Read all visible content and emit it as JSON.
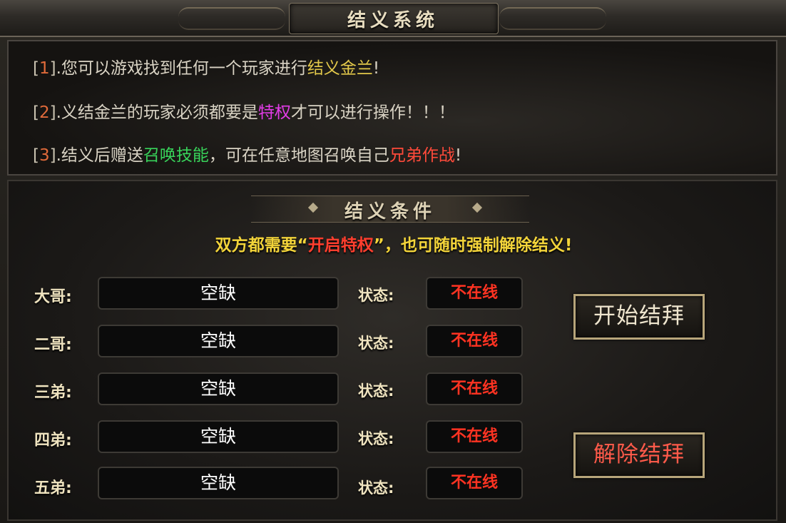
{
  "window": {
    "title": "结义系统"
  },
  "info": {
    "lines": [
      {
        "bl": "[",
        "num": "1",
        "br": "]",
        "pre": ".您可以游戏找到任何一个玩家进行",
        "hl": "结义金兰",
        "post": "!"
      },
      {
        "bl": "[",
        "num": "2",
        "br": "]",
        "pre": ".义结金兰的玩家必须都要是",
        "hl": "特权",
        "post": "才可以进行操作！！！"
      },
      {
        "bl": "[",
        "num": "3",
        "br": "]",
        "pre": ".结义后赠送",
        "hl": "召唤技能",
        "mid": "，可在任意地图召唤自己",
        "hl2": "兄弟作战",
        "post": "!"
      }
    ]
  },
  "conditions": {
    "title": "结义条件",
    "notice_pre": "双方都需要",
    "notice_q1": "“",
    "notice_hl": "开启特权",
    "notice_q2": "”",
    "notice_post": "，也可随时强制解除结义!"
  },
  "members": [
    {
      "role": "大哥:",
      "name": "空缺",
      "status_label": "状态:",
      "status": "不在线"
    },
    {
      "role": "二哥:",
      "name": "空缺",
      "status_label": "状态:",
      "status": "不在线"
    },
    {
      "role": "三弟:",
      "name": "空缺",
      "status_label": "状态:",
      "status": "不在线"
    },
    {
      "role": "四弟:",
      "name": "空缺",
      "status_label": "状态:",
      "status": "不在线"
    },
    {
      "role": "五弟:",
      "name": "空缺",
      "status_label": "状态:",
      "status": "不在线"
    }
  ],
  "buttons": {
    "start": "开始结拜",
    "release": "解除结拜"
  },
  "colors": {
    "gold": "#e2c84a",
    "pink": "#e33ce8",
    "green": "#38d35a",
    "red": "#ff4a3a",
    "offline": "#ff3322"
  }
}
